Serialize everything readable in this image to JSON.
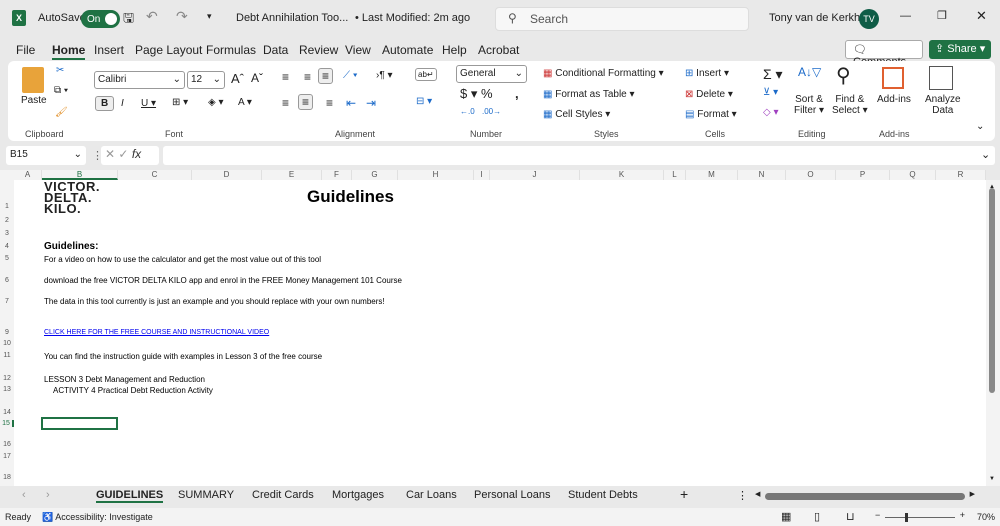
{
  "titlebar": {
    "autosave": "AutoSave",
    "toggle": "On",
    "doc_title": "Debt Annihilation Too...",
    "modified": "• Last Modified: 2m ago",
    "search_placeholder": "Search",
    "user": "Tony van de Kerkhof",
    "initials": "TV"
  },
  "menu": [
    "File",
    "Home",
    "Insert",
    "Page Layout",
    "Formulas",
    "Data",
    "Review",
    "View",
    "Automate",
    "Help",
    "Acrobat"
  ],
  "actions": {
    "comments": "Comments",
    "share": "Share"
  },
  "ribbon": {
    "paste": "Paste",
    "font_name": "Calibri",
    "font_size": "12",
    "number_format": "General",
    "conditional": "Conditional Formatting",
    "format_table": "Format as Table",
    "cell_styles": "Cell Styles",
    "insert": "Insert",
    "delete": "Delete",
    "format": "Format",
    "sort": "Sort &",
    "filter": "Filter",
    "find": "Find &",
    "select": "Select",
    "addins": "Add-ins",
    "analyze1": "Analyze",
    "analyze2": "Data",
    "groups": [
      "Clipboard",
      "Font",
      "Alignment",
      "Number",
      "Styles",
      "Cells",
      "Editing",
      "Add-ins"
    ]
  },
  "formula_bar": {
    "name_box": "B15",
    "formula": ""
  },
  "columns": [
    "A",
    "B",
    "C",
    "D",
    "E",
    "F",
    "G",
    "H",
    "I",
    "J",
    "K",
    "L",
    "M",
    "N",
    "O",
    "P",
    "Q",
    "R"
  ],
  "rows": [
    "1",
    "2",
    "3",
    "4",
    "5",
    "6",
    "7",
    "9",
    "10",
    "11",
    "12",
    "13",
    "14",
    "15",
    "16",
    "17",
    "18"
  ],
  "cells": {
    "logo": [
      "VICTOR.",
      "DELTA.",
      "KILO."
    ],
    "title": "Guidelines",
    "heading": "Guidelines:",
    "r5": "For a video on how to use the calculator and get the most value out of this tool",
    "r6": "download the free VICTOR DELTA KILO app and enrol in the FREE Money Management 101 Course",
    "r7": "The data in this tool currently is just an example and you should replace with your own numbers!",
    "r9": "CLICK HERE FOR THE FREE COURSE AND INSTRUCTIONAL VIDEO",
    "r11": "You can find the instruction guide with examples in Lesson 3 of the free course",
    "r12": "LESSON 3 Debt Management and Reduction",
    "r13": "ACTIVITY 4  Practical Debt Reduction Activity"
  },
  "sheets": [
    "GUIDELINES",
    "SUMMARY",
    "Credit Cards",
    "Mortgages",
    "Car Loans",
    "Personal Loans",
    "Student Debts"
  ],
  "status": {
    "ready": "Ready",
    "accessibility": "Accessibility: Investigate",
    "zoom": "70%"
  },
  "colors": {
    "excel_green": "#1f7244",
    "link": "#0000ee"
  }
}
